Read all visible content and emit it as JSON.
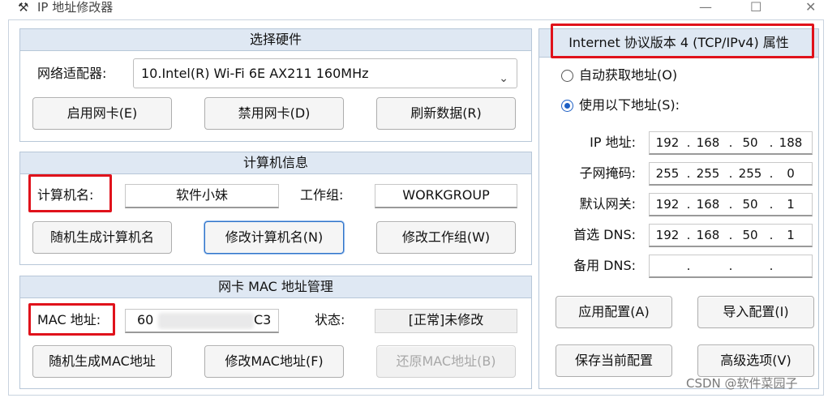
{
  "window": {
    "app_title": "IP 地址修改器",
    "icon_name": "tools-icon",
    "minimize_glyph": "—",
    "maximize_glyph": "☐",
    "close_glyph": "✕"
  },
  "hardware": {
    "title": "选择硬件",
    "adapter_label": "网络适配器:",
    "adapter_value": "10.Intel(R) Wi-Fi 6E AX211 160MHz",
    "enable_btn": "启用网卡(E)",
    "disable_btn": "禁用网卡(D)",
    "refresh_btn": "刷新数据(R)"
  },
  "computer": {
    "title": "计算机信息",
    "name_label": "计算机名:",
    "name_value": "软件小妹",
    "workgroup_label": "工作组:",
    "workgroup_value": "WORKGROUP",
    "random_name_btn": "随机生成计算机名",
    "modify_name_btn": "修改计算机名(N)",
    "modify_workgroup_btn": "修改工作组(W)"
  },
  "mac": {
    "title": "网卡 MAC 地址管理",
    "label": "MAC 地址:",
    "value_start": "60",
    "value_end": "C3",
    "status_label": "状态:",
    "status_value": "[正常]未修改",
    "random_btn": "随机生成MAC地址",
    "modify_btn": "修改MAC地址(F)",
    "restore_btn": "还原MAC地址(B)"
  },
  "tcp": {
    "title": "Internet 协议版本 4 (TCP/IPv4) 属性",
    "auto_option": "自动获取地址(O)",
    "manual_option": "使用以下地址(S):",
    "selected": "manual",
    "rows": [
      {
        "label": "IP 地址:",
        "octets": [
          "192",
          "168",
          "50",
          "188"
        ]
      },
      {
        "label": "子网掩码:",
        "octets": [
          "255",
          "255",
          "255",
          "0"
        ]
      },
      {
        "label": "默认网关:",
        "octets": [
          "192",
          "168",
          "50",
          "1"
        ]
      },
      {
        "label": "首选 DNS:",
        "octets": [
          "192",
          "168",
          "50",
          "1"
        ]
      },
      {
        "label": "备用 DNS:",
        "octets": [
          "",
          "",
          "",
          ""
        ]
      }
    ],
    "apply_btn": "应用配置(A)",
    "import_btn": "导入配置(I)",
    "save_btn": "保存当前配置",
    "advanced_btn": "高级选项(V)"
  },
  "watermark": "CSDN @软件菜园子",
  "colors": {
    "highlight_border": "#e0121b",
    "panel_header": "#dfe8f3",
    "focus_border": "#2f73c8"
  }
}
